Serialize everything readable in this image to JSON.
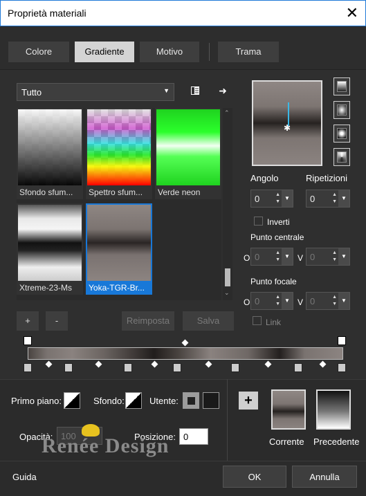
{
  "window": {
    "title": "Proprietà materiali",
    "close_glyph": "✕"
  },
  "tabs": [
    {
      "label": "Colore"
    },
    {
      "label": "Gradiente",
      "active": true
    },
    {
      "label": "Motivo"
    },
    {
      "label": "Trama"
    }
  ],
  "library": {
    "category": "Tutto",
    "icons": {
      "book": "book-icon",
      "arrow": "arrow-right-icon"
    },
    "items": [
      {
        "label": "Sfondo sfum..."
      },
      {
        "label": "Spettro sfum..."
      },
      {
        "label": "Verde neon"
      },
      {
        "label": "Xtreme-23-Ms"
      },
      {
        "label": "Yoka-TGR-Br...",
        "selected": true
      }
    ]
  },
  "actions": {
    "add": "+",
    "remove": "-",
    "reset": "Reimposta",
    "save": "Salva"
  },
  "settings": {
    "angle_label": "Angolo",
    "angle_value": "0",
    "repeat_label": "Ripetizioni",
    "repeat_value": "0",
    "invert_label": "Inverti",
    "center_label": "Punto centrale",
    "center_o_label": "O",
    "center_o_value": "0",
    "center_v_label": "V",
    "center_v_value": "0",
    "focal_label": "Punto focale",
    "focal_o_label": "O",
    "focal_o_value": "0",
    "focal_v_label": "V",
    "focal_v_value": "0",
    "link_label": "Link"
  },
  "colors": {
    "foreground_label": "Primo piano:",
    "background_label": "Sfondo:",
    "user_label": "Utente:",
    "opacity_label": "Opacità:",
    "opacity_value": "100",
    "position_label": "Posizione:",
    "position_value": "0",
    "add": "+",
    "current_label": "Corrente",
    "previous_label": "Precedente",
    "accent": "#1878d8"
  },
  "watermark": "Renée Design",
  "footer": {
    "help": "Guida",
    "ok": "OK",
    "cancel": "Annulla"
  }
}
